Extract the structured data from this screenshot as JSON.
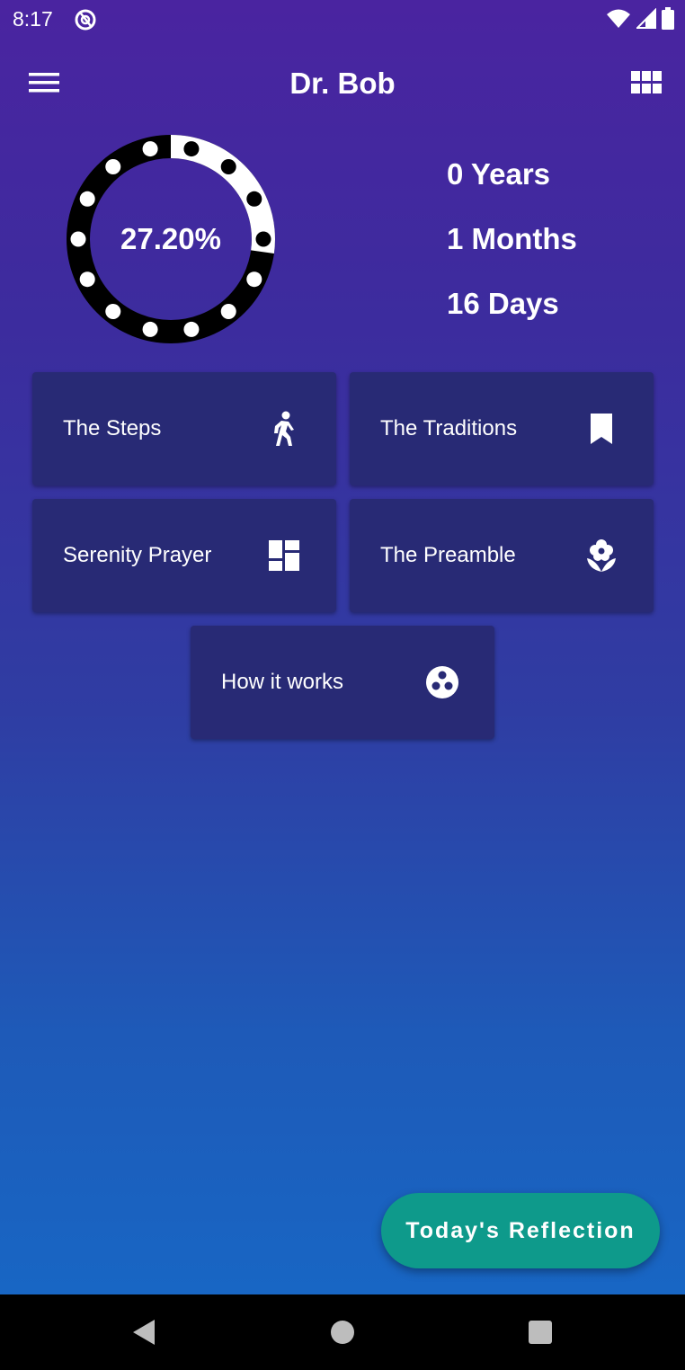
{
  "status_bar": {
    "time": "8:17"
  },
  "appbar": {
    "title": "Dr. Bob"
  },
  "progress": {
    "label": "27.20%",
    "fraction": 0.272,
    "dot_count": 14
  },
  "durations": [
    {
      "text": "0 Years"
    },
    {
      "text": "1 Months"
    },
    {
      "text": "16 Days"
    }
  ],
  "cards": [
    {
      "label": "The Steps",
      "icon": "walking-person-icon"
    },
    {
      "label": "The Traditions",
      "icon": "bookmark-icon"
    },
    {
      "label": "Serenity Prayer",
      "icon": "dashboard-icon"
    },
    {
      "label": "The Preamble",
      "icon": "flower-icon"
    },
    {
      "label": "How it works",
      "icon": "bubbles-icon"
    }
  ],
  "fab": {
    "label": "Today's Reflection"
  },
  "colors": {
    "card_bg": "#282a75",
    "fab_bg": "#0e9a8b",
    "ring_dark": "#000000",
    "ring_light": "#ffffff"
  }
}
